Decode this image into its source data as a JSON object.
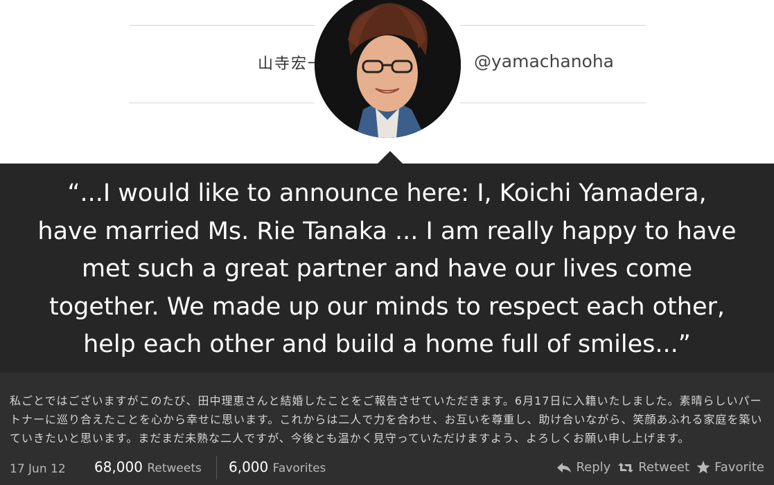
{
  "profile": {
    "name": "山寺宏一",
    "handle": "@yamachanoha"
  },
  "tweet": {
    "quote_lines": [
      "“...I would like to announce here: I, Koichi Yamadera,",
      "have married Ms. Rie Tanaka ... I am really happy to have",
      "met such a great partner and have our lives come",
      "together. We made up our minds to respect each other,",
      "help each other and build a home full of smiles...”"
    ],
    "original_text": "私ごとではございますがこのたび、田中理恵さんと結婚したことをご報告させていただきます。6月17日に入籍いたしました。素晴らしいパートナーに巡り合えたことを心から幸せに思います。これからは二人で力を合わせ、お互いを尊重し、助け合いながら、笑顔あふれる家庭を築いていきたいと思います。まだまだ未熟な二人ですが、今後とも温かく見守っていただけますよう、よろしくお願い申し上げます。",
    "date": "17 Jun 12",
    "retweets_count": "68,000",
    "retweets_label": "Retweets",
    "favorites_count": "6,000",
    "favorites_label": "Favorites"
  },
  "actions": {
    "reply": "Reply",
    "retweet": "Retweet",
    "favorite": "Favorite"
  },
  "icons": {
    "reply": "reply-arrow-icon",
    "retweet": "retweet-icon",
    "favorite": "star-icon"
  }
}
